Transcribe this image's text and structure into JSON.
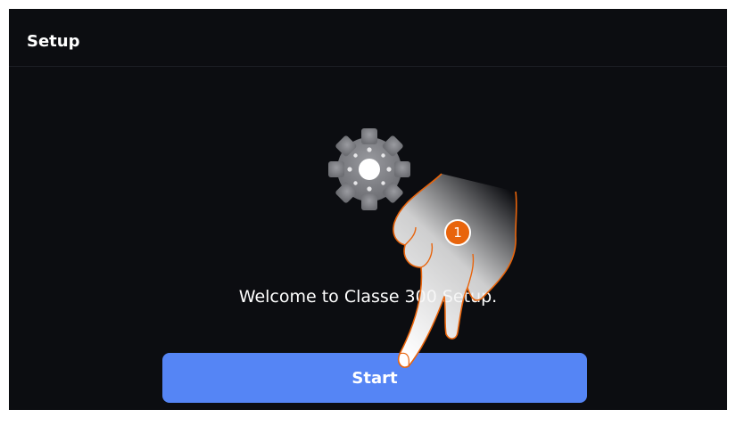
{
  "header": {
    "title": "Setup"
  },
  "main": {
    "icon": "gear-icon",
    "welcome_text": "Welcome to Classe 300 Setup.",
    "start_label": "Start"
  },
  "overlay": {
    "step_number": "1",
    "hand_icon": "pointing-hand-icon"
  },
  "colors": {
    "background": "#0c0d11",
    "button": "#5585f5",
    "step_badge": "#e8640c",
    "hand_outline": "#e8640c"
  }
}
